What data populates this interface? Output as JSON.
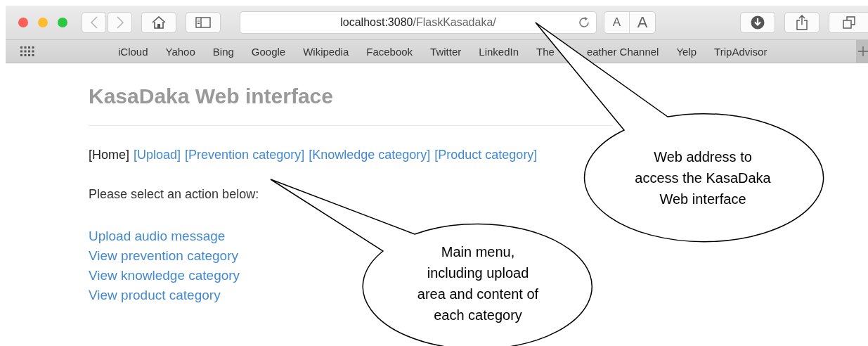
{
  "browser": {
    "address": {
      "host": "localhost:3080",
      "path": "/FlaskKasadaka/"
    },
    "text_size_buttons": [
      "A",
      "A"
    ],
    "bookmarks": [
      "iCloud",
      "Yahoo",
      "Bing",
      "Google",
      "Wikipedia",
      "Facebook",
      "Twitter",
      "LinkedIn",
      {
        "kind": "covered",
        "before": "The",
        "after": "eather Channel"
      },
      "Yelp",
      "TripAdvisor"
    ]
  },
  "page": {
    "heading": "KasaDaka Web interface",
    "nav": [
      {
        "label": "[Home]",
        "selected": true
      },
      {
        "label": "[Upload]",
        "selected": false
      },
      {
        "label": "[Prevention category]",
        "selected": false
      },
      {
        "label": "[Knowledge category]",
        "selected": false
      },
      {
        "label": "[Product category]",
        "selected": false
      }
    ],
    "prompt": "Please select an action below:",
    "actions": [
      "Upload audio message",
      "View prevention category",
      "View knowledge category",
      "View product category"
    ]
  },
  "callouts": [
    {
      "text": "Web address to\naccess the KasaDaka\nWeb interface"
    },
    {
      "text": "Main menu,\nincluding upload\narea and content of\neach category"
    }
  ]
}
